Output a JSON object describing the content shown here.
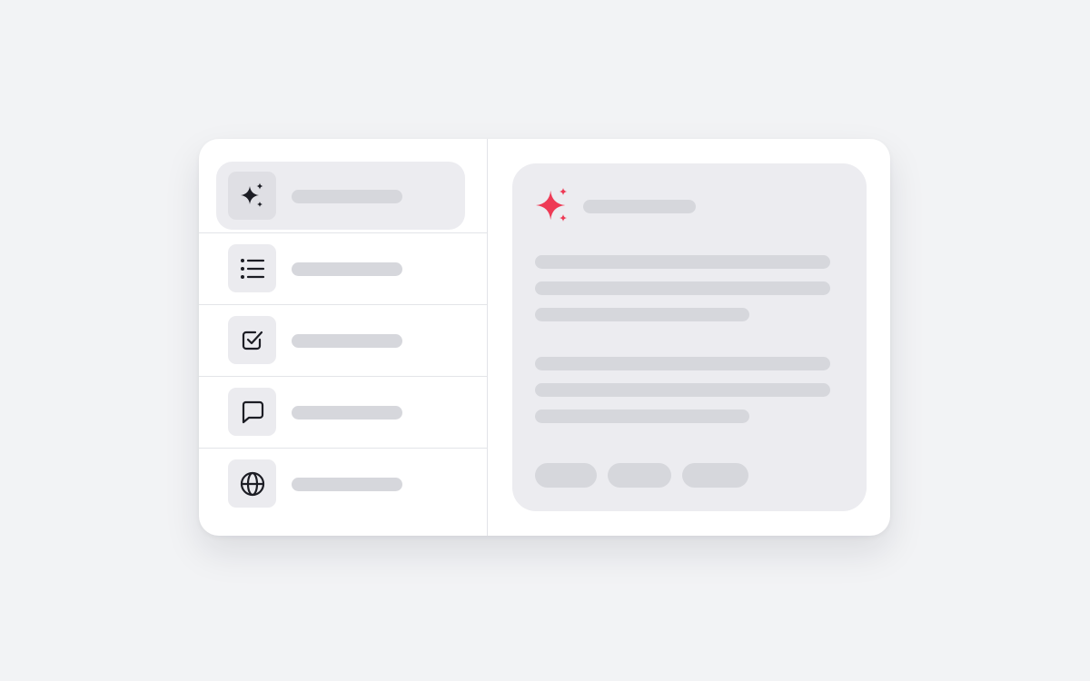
{
  "colors": {
    "background": "#f2f3f5",
    "card": "#ffffff",
    "selected_row": "#ececf0",
    "placeholder": "#d6d7dc",
    "icon": "#1c1d24",
    "accent_sparkle": "#ee3a55"
  },
  "sidebar": {
    "items": [
      {
        "icon": "sparkle-icon",
        "label": "",
        "selected": true
      },
      {
        "icon": "list-icon",
        "label": "",
        "selected": false
      },
      {
        "icon": "checkbox-icon",
        "label": "",
        "selected": false
      },
      {
        "icon": "chat-bubble-icon",
        "label": "",
        "selected": false
      },
      {
        "icon": "globe-icon",
        "label": "",
        "selected": false
      }
    ]
  },
  "detail": {
    "icon": "sparkle-icon",
    "title": "",
    "paragraphs": 2,
    "lines_per_paragraph": 3,
    "chips": 3
  }
}
